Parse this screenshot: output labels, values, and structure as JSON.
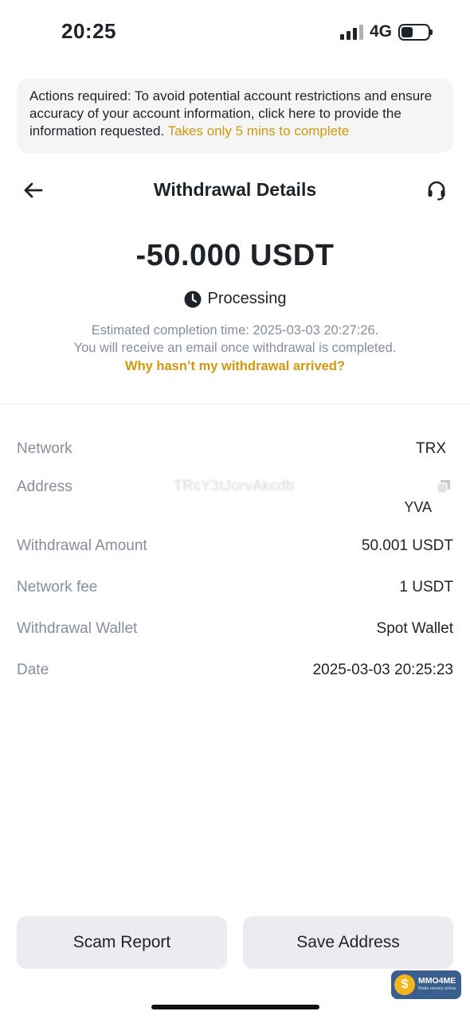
{
  "status_bar": {
    "time": "20:25",
    "network": "4G"
  },
  "notice": {
    "text": "Actions required: To avoid potential account restrictions and ensure accuracy of your account information, click here to provide the information requested. ",
    "link": "Takes only 5 mins to complete"
  },
  "header": {
    "title": "Withdrawal Details",
    "back_icon": "arrow-left-icon",
    "support_icon": "headset-icon"
  },
  "summary": {
    "amount": "-50.000 USDT",
    "status": "Processing",
    "estimate_line1": "Estimated completion time: 2025-03-03 20:27:26.",
    "estimate_line2": "You will receive an email once withdrawal is completed.",
    "why_link": "Why hasn’t my withdrawal arrived?"
  },
  "details": {
    "network": {
      "label": "Network",
      "value": "TRX"
    },
    "address": {
      "label": "Address",
      "line1": "TRcY3tJorvAkcdb",
      "line2": "YVA"
    },
    "withdrawal_amount": {
      "label": "Withdrawal Amount",
      "value": "50.001 USDT"
    },
    "network_fee": {
      "label": "Network fee",
      "value": "1 USDT"
    },
    "withdrawal_wallet": {
      "label": "Withdrawal Wallet",
      "value": "Spot Wallet"
    },
    "date": {
      "label": "Date",
      "value": "2025-03-03 20:25:23"
    }
  },
  "buttons": {
    "scam_report": "Scam Report",
    "save_address": "Save Address"
  },
  "watermark": {
    "brand": "MMO4ME",
    "tagline": "Make money online"
  },
  "colors": {
    "accent": "#d0980b",
    "label_gray": "#848e9c",
    "button_bg": "#eaecef"
  }
}
